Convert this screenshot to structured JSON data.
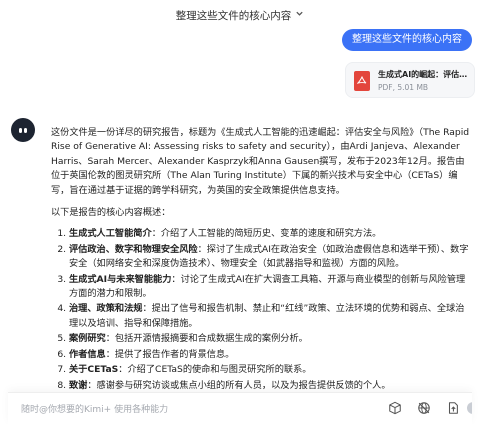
{
  "header": {
    "title": "整理这些文件的核心内容",
    "chevron_icon": "chevron-down-icon"
  },
  "user_message": {
    "text": "整理这些文件的核心内容"
  },
  "attachment": {
    "icon": "pdf-icon",
    "name": "生成式AI的崛起：评估A...",
    "meta": "PDF, 5.01 MB"
  },
  "assistant": {
    "avatar": "kimi-bot-avatar",
    "intro": "这份文件是一份详尽的研究报告，标题为《生成式人工智能的迅速崛起：评估安全与风险》（The Rapid Rise of Generative AI: Assessing risks to safety and security），由Ardi Janjeva、Alexander Harris、Sarah Mercer、Alexander Kasprzyk和Anna Gausen撰写，发布于2023年12月。报告由位于英国伦敦的图灵研究所（The Alan Turing Institute）下属的新兴技术与安全中心（CETaS）编写，旨在通过基于证据的跨学科研究，为英国的安全政策提供信息支持。",
    "subheading": "以下是报告的核心内容概述：",
    "items": [
      {
        "num": "1.",
        "title": "生成式人工智能简介",
        "text": "：介绍了人工智能的简短历史、变革的速度和研究方法。"
      },
      {
        "num": "2.",
        "title": "评估政治、数字和物理安全风险",
        "text": "：探讨了生成式AI在政治安全（如政治虚假信息和选举干预）、数字安全（如网络安全和深度伪造技术）、物理安全（如武器指导和监视）方面的风险。"
      },
      {
        "num": "3.",
        "title": "生成式AI与未来智能能力",
        "text": "：讨论了生成式AI在扩大调查工具箱、开源与商业模型的创新与风险管理方面的潜力和限制。"
      },
      {
        "num": "4.",
        "title": "治理、政策和法规",
        "text": "：提出了信号和报告机制、禁止和“红线”政策、立法环境的优势和弱点、全球治理以及培训、指导和保障措施。"
      },
      {
        "num": "5.",
        "title": "案例研究",
        "text": "：包括开源情报摘要和合成数据生成的案例分析。"
      },
      {
        "num": "6.",
        "title": "作者信息",
        "text": "：提供了报告作者的背景信息。"
      },
      {
        "num": "7.",
        "title": "关于CETaS",
        "text": "：介绍了CETaS的使命和与图灵研究所的联系。"
      },
      {
        "num": "8.",
        "title": "致谢",
        "text": "：感谢参与研究访谈或焦点小组的所有人员，以及为报告提供反馈的个人。"
      }
    ]
  },
  "composer": {
    "placeholder": "随时@你想要的Kimi+ 使用各种能力",
    "icons": [
      "cube-icon",
      "no-web-search-icon",
      "upload-icon",
      "send-icon"
    ]
  },
  "colors": {
    "accent": "#3b72f6",
    "pdf_red": "#e3463c",
    "avatar_bg": "#1d2431"
  }
}
